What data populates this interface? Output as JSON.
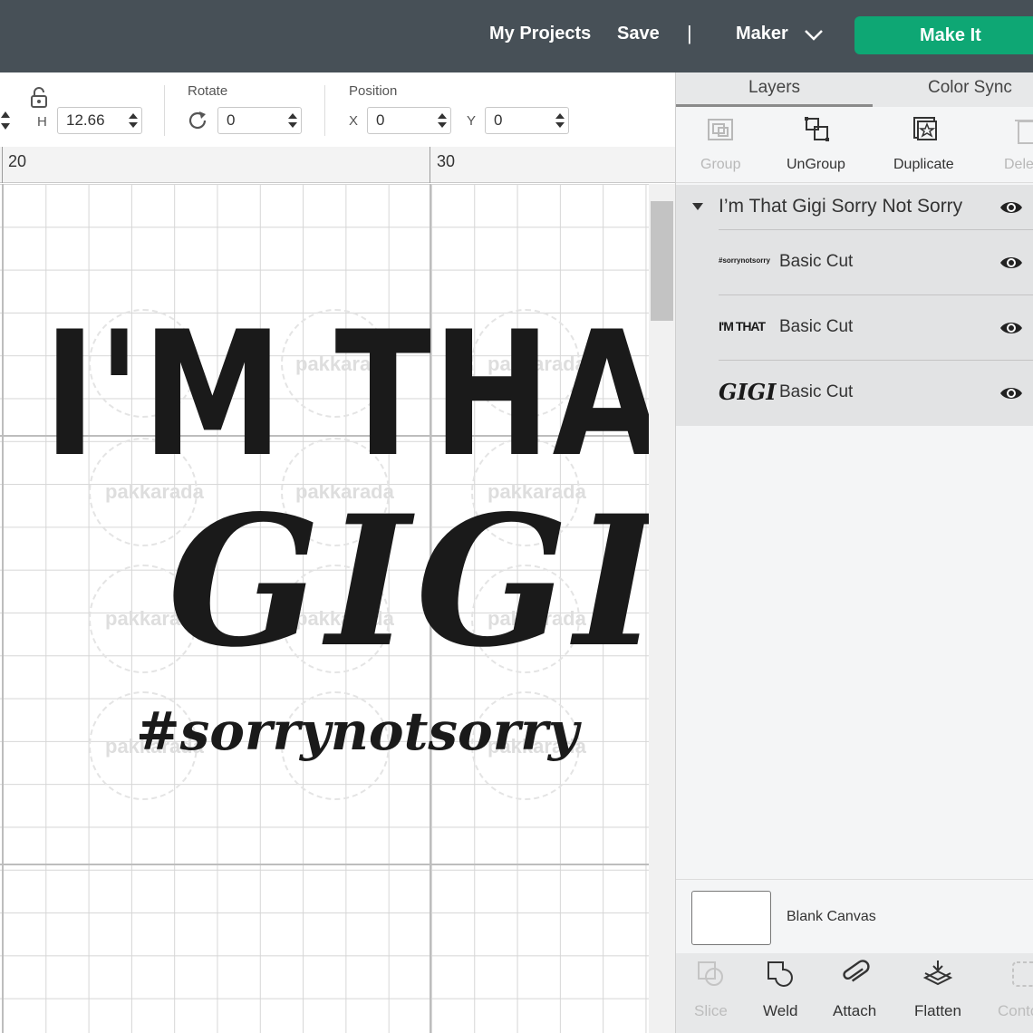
{
  "header": {
    "my_projects": "My Projects",
    "save": "Save",
    "separator": "|",
    "machine": "Maker",
    "make_it": "Make It",
    "colors": {
      "bar": "#475057",
      "make_it": "#0ea774"
    }
  },
  "toolbar": {
    "h_label": "H",
    "h_value": "12.66",
    "rotate_label": "Rotate",
    "rotate_value": "0",
    "position_label": "Position",
    "x_label": "X",
    "x_value": "0",
    "y_label": "Y",
    "y_value": "0"
  },
  "ruler": {
    "ticks": [
      "20",
      "30"
    ]
  },
  "canvas": {
    "line1": "I'M THAT",
    "line2": "GIGI",
    "line3": "#sorrynotsorry",
    "watermark": "pakkarada"
  },
  "panel": {
    "tabs": [
      "Layers",
      "Color Sync"
    ],
    "actions": [
      "Group",
      "UnGroup",
      "Duplicate",
      "Dele"
    ],
    "group_name": "I’m That Gigi Sorry Not Sorry",
    "layers": [
      {
        "thumb": "#sorrynotsorry",
        "label": "Basic Cut"
      },
      {
        "thumb": "I'M THAT",
        "label": "Basic Cut"
      },
      {
        "thumb": "GIGI",
        "label": "Basic Cut"
      }
    ],
    "blank_canvas": "Blank Canvas",
    "bottom_actions": [
      "Slice",
      "Weld",
      "Attach",
      "Flatten",
      "Conto"
    ]
  }
}
